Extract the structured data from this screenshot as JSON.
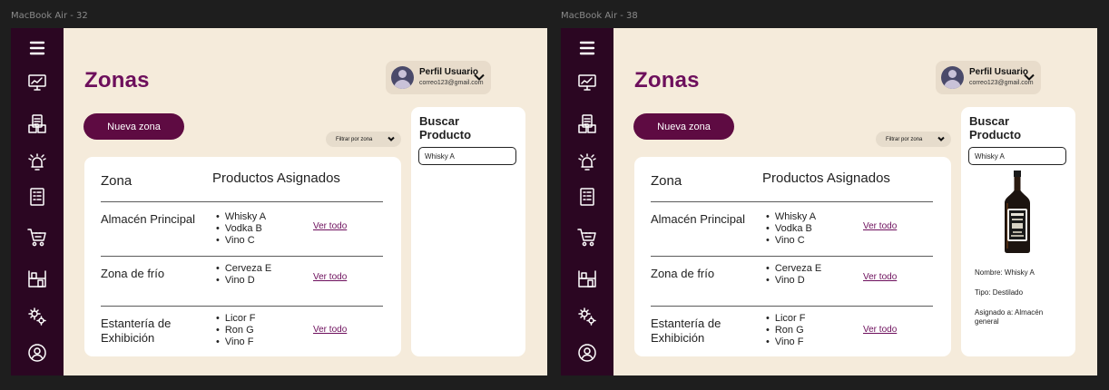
{
  "frames": [
    {
      "label": "MacBook Air - 32",
      "title": "Zonas",
      "profile": {
        "name": "Perfil Usuario",
        "email": "correo123@gmail.com"
      },
      "new_zone_button": "Nueva zona",
      "filter_label": "Filtrar por zona",
      "table": {
        "headers": [
          "Zona",
          "Productos Asignados"
        ],
        "rows": [
          {
            "zone": "Almacén Principal",
            "products": [
              "Whisky A",
              "Vodka B",
              "Vino C"
            ],
            "link": "Ver todo"
          },
          {
            "zone": "Zona de frío",
            "products": [
              "Cerveza E",
              "Vino D"
            ],
            "link": "Ver todo"
          },
          {
            "zone": "Estantería de Exhibición",
            "products": [
              "Licor F",
              "Ron G",
              "Vino F"
            ],
            "link": "Ver todo"
          }
        ]
      },
      "search": {
        "title": "Buscar Producto",
        "value": "Whisky A"
      },
      "result": null
    },
    {
      "label": "MacBook Air - 38",
      "title": "Zonas",
      "profile": {
        "name": "Perfil Usuario",
        "email": "correo123@gmail.com"
      },
      "new_zone_button": "Nueva zona",
      "filter_label": "Filtrar por zona",
      "table": {
        "headers": [
          "Zona",
          "Productos Asignados"
        ],
        "rows": [
          {
            "zone": "Almacén Principal",
            "products": [
              "Whisky A",
              "Vodka B",
              "Vino C"
            ],
            "link": "Ver todo"
          },
          {
            "zone": "Zona de frío",
            "products": [
              "Cerveza E",
              "Vino D"
            ],
            "link": "Ver todo"
          },
          {
            "zone": "Estantería de Exhibición",
            "products": [
              "Licor F",
              "Ron G",
              "Vino F"
            ],
            "link": "Ver todo"
          }
        ]
      },
      "search": {
        "title": "Buscar Producto",
        "value": "Whisky A"
      },
      "result": {
        "image_icon": "whisky-bottle-icon",
        "name": "Nombre: Whisky A",
        "type": "Tipo: Destilado",
        "assigned": "Asignado a: Almacén general"
      }
    }
  ],
  "sidebar_icons": [
    "menu-icon",
    "dashboard-icon",
    "inventory-icon",
    "alarm-icon",
    "report-icon",
    "cart-icon",
    "warehouse-icon",
    "settings-icon",
    "user-icon"
  ],
  "colors": {
    "sidebar": "#2b0622",
    "accent": "#6d0f5c",
    "button": "#5e0b42",
    "background": "#f5ebdb",
    "canvas": "#1e1e1e"
  }
}
